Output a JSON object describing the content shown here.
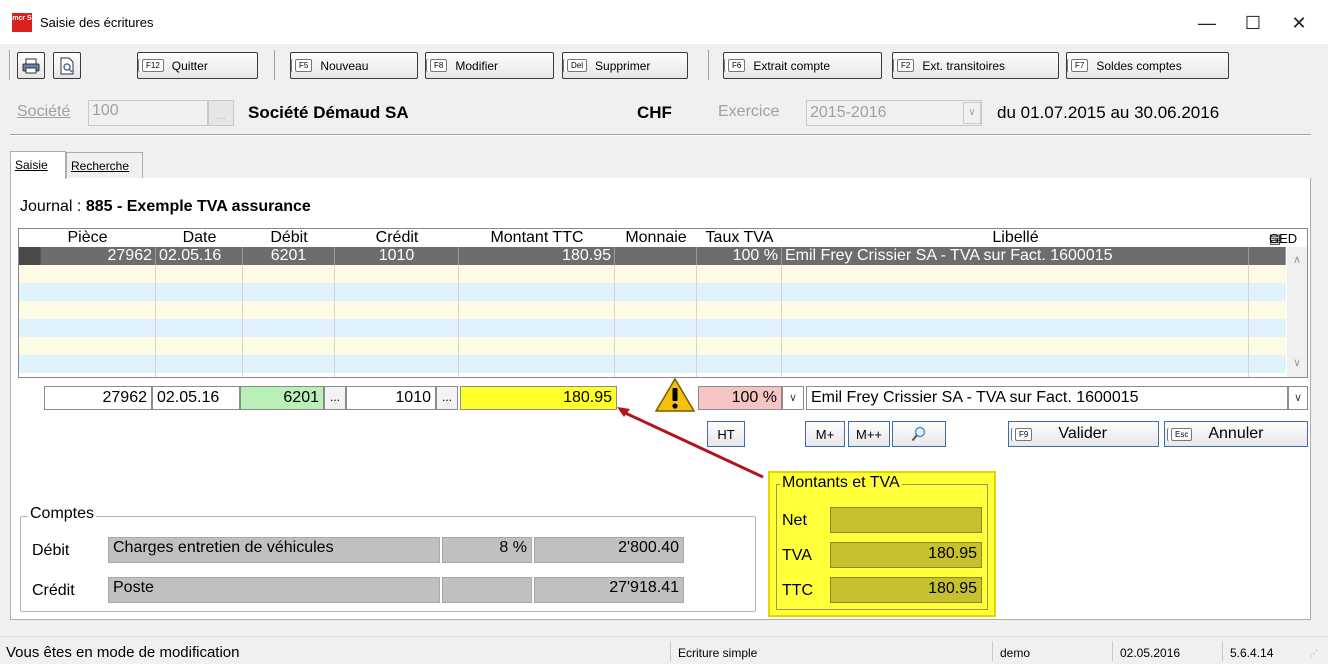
{
  "window": {
    "logo": "mcr S",
    "title": "Saisie des écritures",
    "minimize": "—",
    "maximize": "☐",
    "close": "✕"
  },
  "toolbar": {
    "quit": {
      "key": "F12",
      "label": "Quitter"
    },
    "new": {
      "key": "F5",
      "label": "Nouveau"
    },
    "modify": {
      "key": "F8",
      "label": "Modifier"
    },
    "delete": {
      "key": "Del",
      "label": "Supprimer"
    },
    "extract": {
      "key": "F6",
      "label": "Extrait compte"
    },
    "transit": {
      "key": "F2",
      "label": "Ext. transitoires"
    },
    "balances": {
      "key": "F7",
      "label": "Soldes comptes"
    }
  },
  "header": {
    "company_label": "Société",
    "company_code": "100",
    "company_name": "Société Démaud SA",
    "currency": "CHF",
    "year_label": "Exercice",
    "year_value": "2015-2016",
    "period": "du 01.07.2015 au 30.06.2016"
  },
  "tabs": [
    {
      "label": "Saisie"
    },
    {
      "label": "Recherche"
    }
  ],
  "journal": {
    "label": "Journal :",
    "value": "885 - Exemple TVA assurance"
  },
  "grid": {
    "columns": [
      "Pièce",
      "Date",
      "Débit",
      "Crédit",
      "Montant TTC",
      "Monnaie",
      "Taux TVA",
      "Libellé",
      "GED"
    ],
    "rows": [
      {
        "piece": "27962",
        "date": "02.05.16",
        "debit": "6201",
        "credit": "1010",
        "amount": "180.95",
        "currency": "",
        "vat": "100 %",
        "label": "Emil Frey Crissier SA - TVA sur Fact. 1600015"
      }
    ]
  },
  "entry": {
    "piece": "27962",
    "date": "02.05.16",
    "debit": "6201",
    "credit": "1010",
    "amount": "180.95",
    "vat": "100 %",
    "label": "Emil Frey Crissier SA - TVA sur Fact. 1600015",
    "dots": "..."
  },
  "buttons": {
    "ht": "HT",
    "mplus": "M+",
    "mplusplus": "M++",
    "validate_key": "F9",
    "validate": "Valider",
    "cancel_key": "Esc",
    "cancel": "Annuler"
  },
  "accounts": {
    "title": "Comptes",
    "debit": {
      "label": "Débit",
      "name": "Charges entretien de véhicules",
      "rate": "8 %",
      "balance": "2'800.40"
    },
    "credit": {
      "label": "Crédit",
      "name": "Poste",
      "rate": "",
      "balance": "27'918.41"
    }
  },
  "amounts": {
    "title": "Montants et TVA",
    "net_label": "Net",
    "net": "",
    "vat_label": "TVA",
    "vat": "180.95",
    "ttc_label": "TTC",
    "ttc": "180.95"
  },
  "status": {
    "mode": "Vous êtes en mode de modification",
    "type": "Ecriture simple",
    "user": "demo",
    "date": "02.05.2016",
    "version": "5.6.4.14"
  },
  "colors": {
    "selected_row": "#6d6d6d",
    "row_blue": "#e0f2fc",
    "row_yellow": "#fefbe4",
    "highlight_yellow": "#ffff2a",
    "debit_green": "#b8f0b8",
    "vat_pink": "#f7c4c4",
    "annotation_red": "#b2141e",
    "warning": "#f4c20d"
  }
}
